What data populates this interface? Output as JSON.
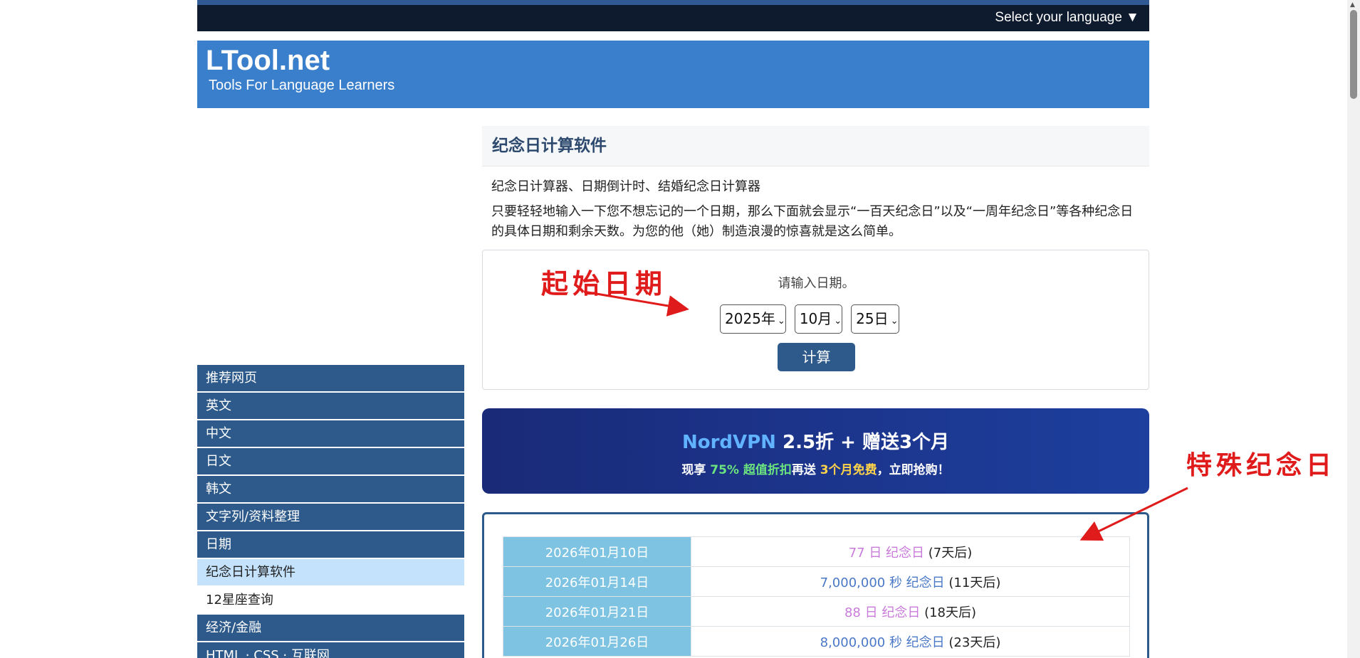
{
  "language_bar": {
    "label": "Select your language ▼"
  },
  "header": {
    "logo": "LTool.net",
    "tagline": "Tools For Language Learners"
  },
  "sidebar": {
    "items": [
      {
        "label": "推荐网页"
      },
      {
        "label": "英文"
      },
      {
        "label": "中文"
      },
      {
        "label": "日文"
      },
      {
        "label": "韩文"
      },
      {
        "label": "文字列/资料整理"
      },
      {
        "label": "日期"
      },
      {
        "label": "纪念日计算软件"
      },
      {
        "label": "12星座查询"
      },
      {
        "label": "经济/金融"
      },
      {
        "label": "HTML · CSS · 互联网"
      }
    ]
  },
  "main": {
    "title": "纪念日计算软件",
    "subtitle": "纪念日计算器、日期倒计时、结婚纪念日计算器",
    "description": "只要轻轻地输入一下您不想忘记的一个日期，那么下面就会显示“一百天纪念日”以及“一周年纪念日”等各种纪念日的具体日期和剩余天数。为您的他（她）制造浪漫的惊喜就是这么简单。",
    "prompt": "请输入日期。",
    "year_value": "2025年",
    "month_value": "10月",
    "day_value": "25日",
    "calc_label": "计算"
  },
  "annotations": {
    "start_date": "起始日期",
    "special_day": "特殊纪念日"
  },
  "ad": {
    "brand": "NordVPN",
    "title_rest": " 2.5折 + 赠送3个月",
    "sub_pre": "现享 ",
    "sub_green": "75% 超值折扣",
    "sub_mid": "再送 ",
    "sub_yellow": "3个月免费",
    "sub_post": "，立即抢购！"
  },
  "results": [
    {
      "date": "2026年01月10日",
      "num": "77 日 纪念日",
      "rest": " (7天后)"
    },
    {
      "date": "2026年01月14日",
      "num": "7,000,000 秒 纪念日",
      "rest": " (11天后)"
    },
    {
      "date": "2026年01月21日",
      "num": "88 日 纪念日",
      "rest": " (18天后)"
    },
    {
      "date": "2026年01月26日",
      "num": "8,000,000 秒 纪念日",
      "rest": " (23天后)"
    }
  ],
  "colors": {
    "header": "#3a7fcc",
    "nav": "#2d5a8a",
    "annotation": "#e01b1b"
  }
}
